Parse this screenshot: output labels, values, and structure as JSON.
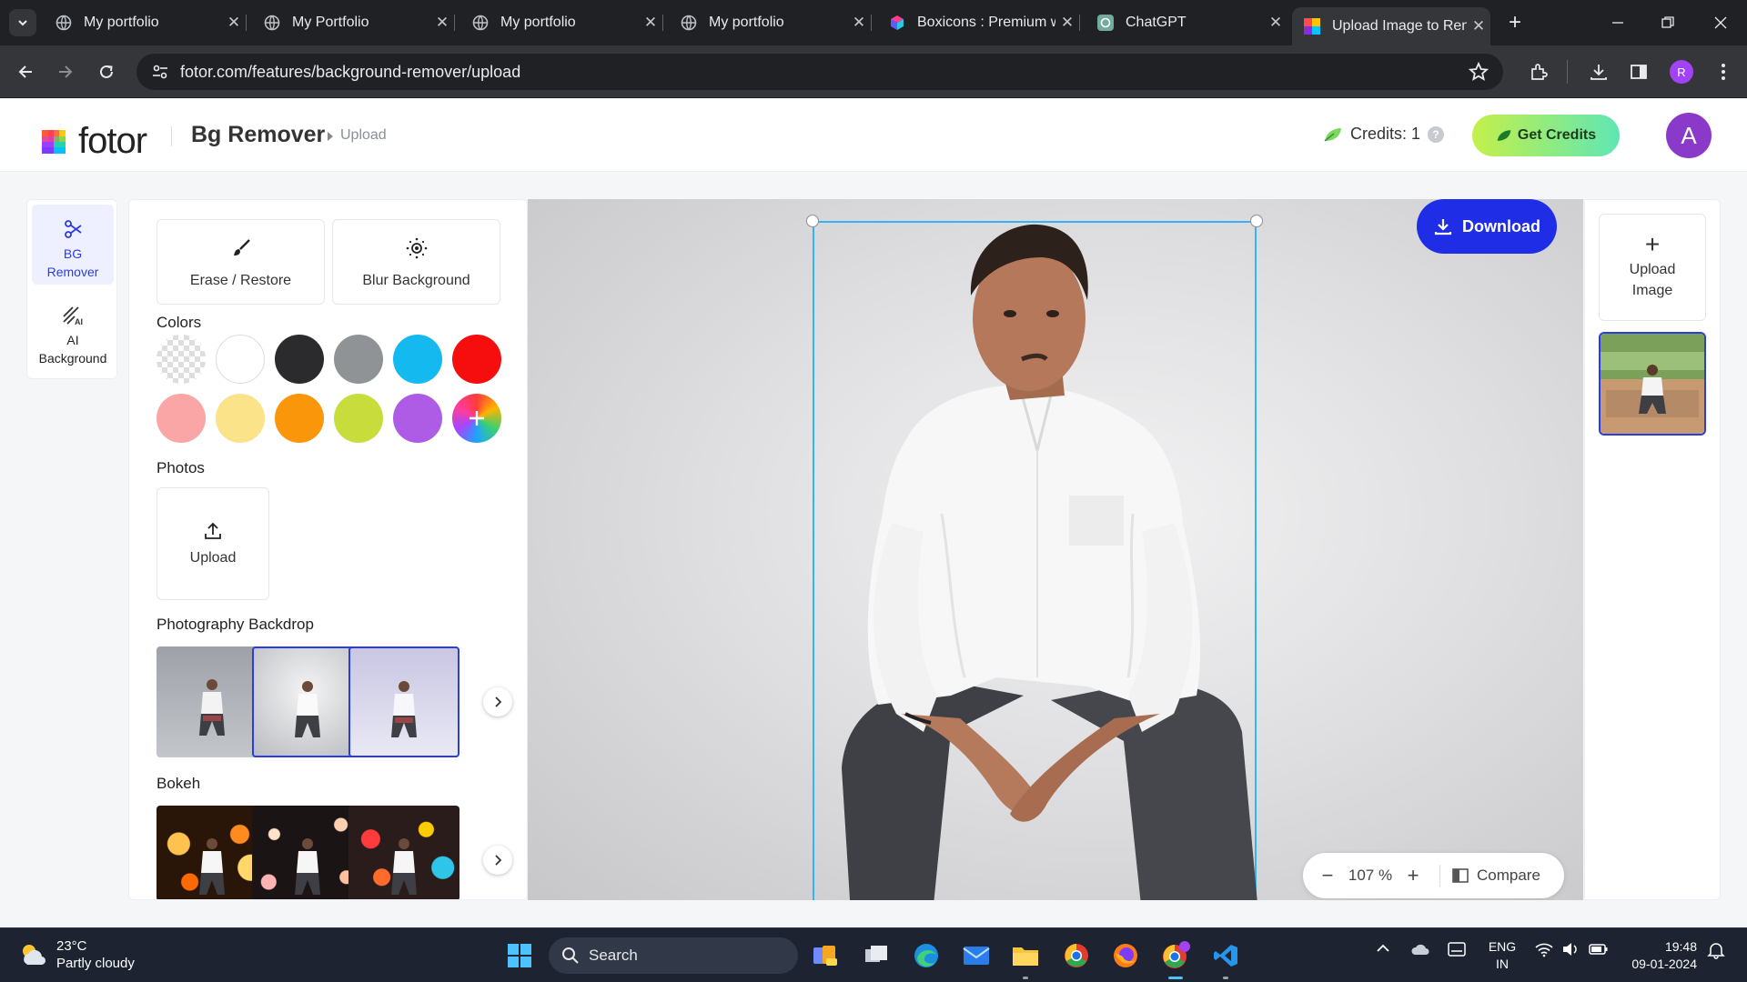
{
  "browser": {
    "tabs": [
      {
        "label": "My portfolio"
      },
      {
        "label": "My Portfolio"
      },
      {
        "label": "My portfolio"
      },
      {
        "label": "My portfolio"
      },
      {
        "label": "Boxicons : Premium w"
      },
      {
        "label": "ChatGPT"
      },
      {
        "label": "Upload Image to Ren"
      }
    ],
    "url": "fotor.com/features/background-remover/upload",
    "profile_initial": "R"
  },
  "header": {
    "logo": "fotor",
    "title": "Bg Remover",
    "breadcrumb": "Upload",
    "credits_label": "Credits: 1",
    "help": "?",
    "get_credits": "Get Credits",
    "avatar": "A"
  },
  "rail": {
    "items": [
      {
        "label": "BG Remover",
        "icon": "scissors-icon"
      },
      {
        "label": "AI Background",
        "icon": "ai-background-icon"
      }
    ]
  },
  "panel": {
    "erase_restore": "Erase / Restore",
    "blur_background": "Blur Background",
    "colors_title": "Colors",
    "colors": [
      "transparent",
      "#ffffff",
      "#2b2b2d",
      "#909396",
      "#14b9f0",
      "#f60d0d",
      "#fba6a6",
      "#fbe38a",
      "#fa960a",
      "#c8dc3c",
      "#ae5ce6",
      "rainbow-add"
    ],
    "photos_title": "Photos",
    "upload": "Upload",
    "backdrop_title": "Photography Backdrop",
    "bokeh_title": "Bokeh"
  },
  "canvas": {
    "download": "Download",
    "zoom": "107 %",
    "compare": "Compare"
  },
  "right": {
    "upload_image": "Upload Image"
  },
  "taskbar": {
    "temp": "23°C",
    "weather": "Partly cloudy",
    "search": "Search",
    "lang_1": "ENG",
    "lang_2": "IN",
    "time": "19:48",
    "date": "09-01-2024"
  }
}
